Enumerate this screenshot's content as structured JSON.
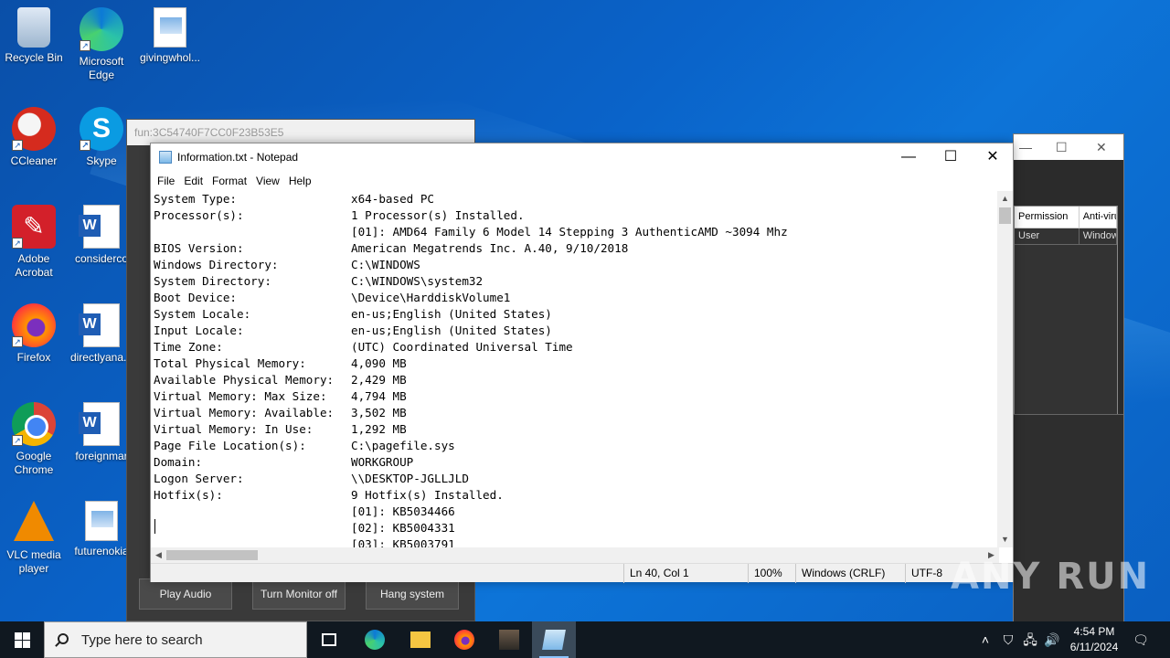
{
  "desktop": {
    "icons": [
      {
        "label": "Recycle Bin"
      },
      {
        "label": "Microsoft Edge"
      },
      {
        "label": "givingwhol..."
      },
      {
        "label": "CCleaner"
      },
      {
        "label": "Skype"
      },
      {
        "label": "Adobe Acrobat"
      },
      {
        "label": "considerco"
      },
      {
        "label": "Firefox"
      },
      {
        "label": "directlyana..."
      },
      {
        "label": "Google Chrome"
      },
      {
        "label": "foreignmar"
      },
      {
        "label": "VLC media player"
      },
      {
        "label": "futurenokia"
      }
    ]
  },
  "bg_window": {
    "title": "fun:3C54740F7CC0F23B53E5",
    "buttons": [
      "Play Audio",
      "Turn Monitor off",
      "Hang system"
    ]
  },
  "right_window": {
    "columns": [
      "Permission",
      "Anti-viru"
    ],
    "row1": [
      "User",
      "Window"
    ]
  },
  "notepad": {
    "title": "Information.txt - Notepad",
    "menu": [
      "File",
      "Edit",
      "Format",
      "View",
      "Help"
    ],
    "lines": [
      {
        "label": "System Type:",
        "value": "x64-based PC"
      },
      {
        "label": "Processor(s):",
        "value": "1 Processor(s) Installed."
      },
      {
        "label": "",
        "value": "[01]: AMD64 Family 6 Model 14 Stepping 3 AuthenticAMD ~3094 Mhz"
      },
      {
        "label": "BIOS Version:",
        "value": "American Megatrends Inc. A.40, 9/10/2018"
      },
      {
        "label": "Windows Directory:",
        "value": "C:\\WINDOWS"
      },
      {
        "label": "System Directory:",
        "value": "C:\\WINDOWS\\system32"
      },
      {
        "label": "Boot Device:",
        "value": "\\Device\\HarddiskVolume1"
      },
      {
        "label": "System Locale:",
        "value": "en-us;English (United States)"
      },
      {
        "label": "Input Locale:",
        "value": "en-us;English (United States)"
      },
      {
        "label": "Time Zone:",
        "value": "(UTC) Coordinated Universal Time"
      },
      {
        "label": "Total Physical Memory:",
        "value": "4,090 MB"
      },
      {
        "label": "Available Physical Memory:",
        "value": "2,429 MB"
      },
      {
        "label": "Virtual Memory: Max Size:",
        "value": "4,794 MB"
      },
      {
        "label": "Virtual Memory: Available:",
        "value": "3,502 MB"
      },
      {
        "label": "Virtual Memory: In Use:",
        "value": "1,292 MB"
      },
      {
        "label": "Page File Location(s):",
        "value": "C:\\pagefile.sys"
      },
      {
        "label": "Domain:",
        "value": "WORKGROUP"
      },
      {
        "label": "Logon Server:",
        "value": "\\\\DESKTOP-JGLLJLD"
      },
      {
        "label": "Hotfix(s):",
        "value": "9 Hotfix(s) Installed."
      },
      {
        "label": "",
        "value": "[01]: KB5034466"
      },
      {
        "label": "",
        "value": "[02]: KB5004331"
      },
      {
        "label": "",
        "value": "[03]: KB5003791"
      }
    ],
    "status": {
      "position": "Ln 40, Col 1",
      "zoom": "100%",
      "line_ending": "Windows (CRLF)",
      "encoding": "UTF-8"
    }
  },
  "watermark": "ANY RUN",
  "taskbar": {
    "search_placeholder": "Type here to search",
    "time": "4:54 PM",
    "date": "6/11/2024"
  }
}
